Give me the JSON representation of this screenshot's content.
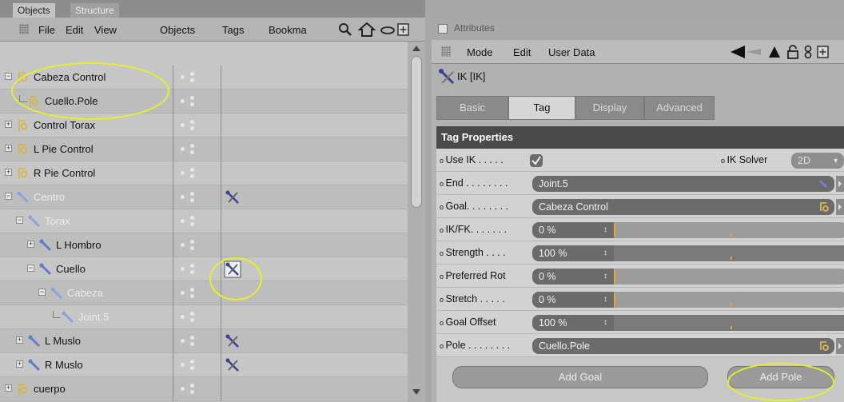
{
  "objects_panel": {
    "tabs": [
      "Objects",
      "Structure"
    ],
    "menu": [
      "File",
      "Edit",
      "View",
      "Objects",
      "Tags",
      "Bookma"
    ],
    "rows": [
      {
        "name": "Cabeza Control",
        "level": 0,
        "type": "null",
        "dim": false
      },
      {
        "name": "Cuello.Pole",
        "level": 1,
        "type": "null",
        "dim": false
      },
      {
        "name": "Control Torax",
        "level": 0,
        "type": "null",
        "dim": false
      },
      {
        "name": "L Pie Control",
        "level": 0,
        "type": "null",
        "dim": false
      },
      {
        "name": "R Pie Control",
        "level": 0,
        "type": "null",
        "dim": false
      },
      {
        "name": "Centro",
        "level": 0,
        "type": "joint",
        "dim": true,
        "tag": "ik"
      },
      {
        "name": "Torax",
        "level": 1,
        "type": "joint",
        "dim": true
      },
      {
        "name": "L Hombro",
        "level": 2,
        "type": "joint",
        "dim": false
      },
      {
        "name": "Cuello",
        "level": 2,
        "type": "joint",
        "dim": false,
        "tag": "ik-selected"
      },
      {
        "name": "Cabeza",
        "level": 3,
        "type": "joint",
        "dim": true
      },
      {
        "name": "Joint.5",
        "level": 4,
        "type": "joint",
        "dim": true
      },
      {
        "name": "L Muslo",
        "level": 1,
        "type": "joint",
        "dim": false,
        "tag": "ik"
      },
      {
        "name": "R Muslo",
        "level": 1,
        "type": "joint",
        "dim": false,
        "tag": "ik"
      },
      {
        "name": "cuerpo",
        "level": 0,
        "type": "null",
        "dim": false
      }
    ]
  },
  "attributes_panel": {
    "title": "Attributes",
    "menu": [
      "Mode",
      "Edit",
      "User Data"
    ],
    "object_title": "IK [IK]",
    "tabs": [
      "Basic",
      "Tag",
      "Display",
      "Advanced"
    ],
    "selected_tab": "Tag",
    "section": "Tag Properties",
    "use_ik_label": "Use IK . . . . .",
    "ik_solver_label": "IK Solver",
    "ik_solver_value": "2D",
    "end_label": "End . . . . . . . .",
    "end_value": "Joint.5",
    "goal_label": "Goal. . . . . . . .",
    "goal_value": "Cabeza Control",
    "ikfk_label": "IK/FK. . . . . . .",
    "ikfk_value": "0 %",
    "strength_label": "Strength . . . .",
    "strength_value": "100 %",
    "prefrot_label": "Preferred Rot",
    "prefrot_value": "0 %",
    "stretch_label": "Stretch . . . . .",
    "stretch_value": "0 %",
    "goaloffset_label": "Goal Offset",
    "goaloffset_value": "100 %",
    "pole_label": "Pole . . . . . . . .",
    "pole_value": "Cuello.Pole",
    "add_goal": "Add Goal",
    "add_pole": "Add Pole",
    "sliders": {
      "ikfk": 0,
      "strength": 1,
      "prefrot": 0,
      "stretch": 0,
      "goaloffset": 1
    }
  },
  "colors": {
    "highlight": "#e6f028",
    "slider_tick": "#e8a42a",
    "ik_icon": "#3a3f9a"
  }
}
